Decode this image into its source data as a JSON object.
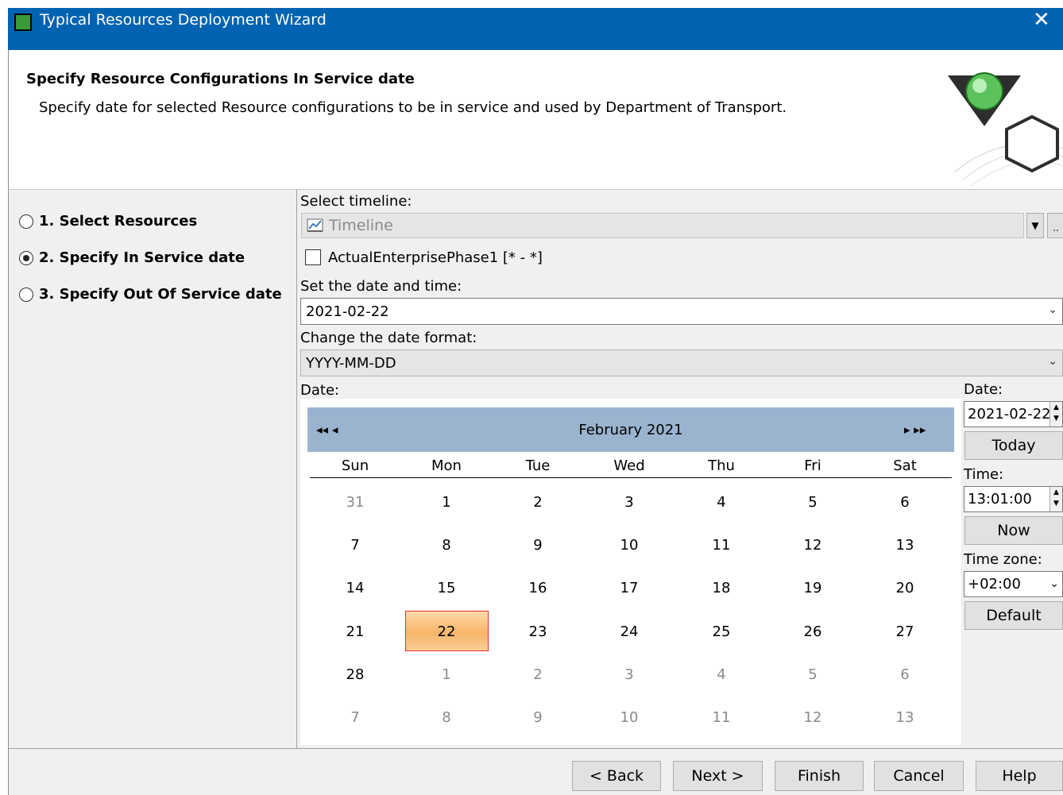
{
  "window": {
    "title": "Typical Resources Deployment Wizard",
    "close_glyph": "✕"
  },
  "header": {
    "title": "Specify Resource Configurations In Service date",
    "subtitle": "Specify date for selected Resource configurations to be in service and used by Department of Transport."
  },
  "steps": [
    {
      "label": "1. Select Resources",
      "selected": false
    },
    {
      "label": "2. Specify In Service date",
      "selected": true
    },
    {
      "label": "3. Specify Out Of Service date",
      "selected": false
    }
  ],
  "form": {
    "select_timeline_label": "Select timeline:",
    "timeline_value": "Timeline",
    "timeline_more": "..",
    "phase_checkbox_label": "ActualEnterprisePhase1 [* - *]",
    "phase_checked": false,
    "set_date_label": "Set the date and time:",
    "date_value": "2021-02-22",
    "change_format_label": "Change the date format:",
    "format_value": "YYYY-MM-DD",
    "date_label": "Date:"
  },
  "calendar": {
    "month_title": "February 2021",
    "nav_prev": "◂◂  ◂",
    "nav_next": "▸  ▸▸",
    "weekdays": [
      "Sun",
      "Mon",
      "Tue",
      "Wed",
      "Thu",
      "Fri",
      "Sat"
    ],
    "weeks": [
      [
        "31",
        "1",
        "2",
        "3",
        "4",
        "5",
        "6"
      ],
      [
        "7",
        "8",
        "9",
        "10",
        "11",
        "12",
        "13"
      ],
      [
        "14",
        "15",
        "16",
        "17",
        "18",
        "19",
        "20"
      ],
      [
        "21",
        "22",
        "23",
        "24",
        "25",
        "26",
        "27"
      ],
      [
        "28",
        "1",
        "2",
        "3",
        "4",
        "5",
        "6"
      ],
      [
        "7",
        "8",
        "9",
        "10",
        "11",
        "12",
        "13"
      ]
    ],
    "selected_day": "22"
  },
  "side": {
    "date_label": "Date:",
    "date_value": "2021-02-22",
    "today_button": "Today",
    "time_label": "Time:",
    "time_value": "13:01:00",
    "now_button": "Now",
    "timezone_label": "Time zone:",
    "timezone_value": "+02:00",
    "default_button": "Default"
  },
  "footer": {
    "back": "< Back",
    "next": "Next >",
    "finish": "Finish",
    "cancel": "Cancel",
    "help": "Help"
  }
}
